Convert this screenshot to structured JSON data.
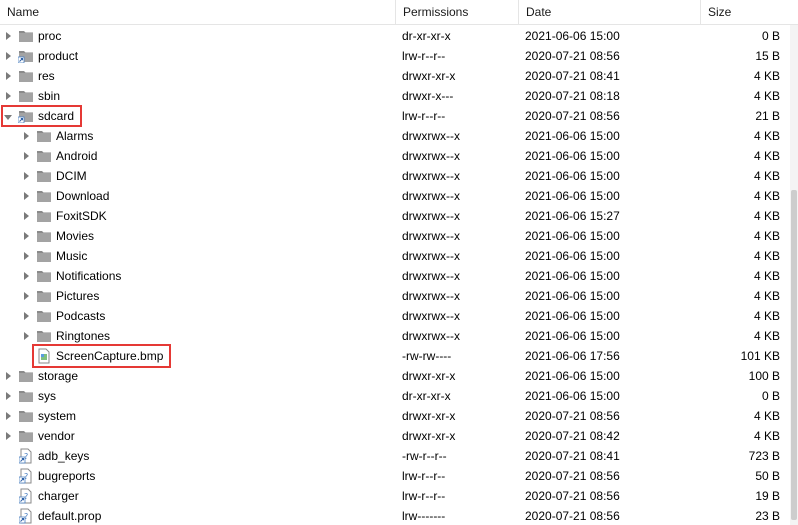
{
  "columns": {
    "name": "Name",
    "permissions": "Permissions",
    "date": "Date",
    "size": "Size"
  },
  "icons": {
    "folder": "folder-icon",
    "file": "file-icon",
    "link": "link-icon"
  },
  "colors": {
    "highlight": "#e53935",
    "folder": "#8a8a8a"
  },
  "rows": [
    {
      "name": "proc",
      "permissions": "dr-xr-xr-x",
      "date": "2021-06-06 15:00",
      "size": "0 B",
      "indent": 0,
      "expander": "collapsed",
      "icon": "folder"
    },
    {
      "name": "product",
      "permissions": "lrw-r--r--",
      "date": "2020-07-21 08:56",
      "size": "15 B",
      "indent": 0,
      "expander": "collapsed",
      "icon": "folder-link"
    },
    {
      "name": "res",
      "permissions": "drwxr-xr-x",
      "date": "2020-07-21 08:41",
      "size": "4 KB",
      "indent": 0,
      "expander": "collapsed",
      "icon": "folder"
    },
    {
      "name": "sbin",
      "permissions": "drwxr-x---",
      "date": "2020-07-21 08:18",
      "size": "4 KB",
      "indent": 0,
      "expander": "collapsed",
      "icon": "folder"
    },
    {
      "name": "sdcard",
      "permissions": "lrw-r--r--",
      "date": "2020-07-21 08:56",
      "size": "21 B",
      "indent": 0,
      "expander": "expanded",
      "icon": "folder-link"
    },
    {
      "name": "Alarms",
      "permissions": "drwxrwx--x",
      "date": "2021-06-06 15:00",
      "size": "4 KB",
      "indent": 1,
      "expander": "collapsed",
      "icon": "folder"
    },
    {
      "name": "Android",
      "permissions": "drwxrwx--x",
      "date": "2021-06-06 15:00",
      "size": "4 KB",
      "indent": 1,
      "expander": "collapsed",
      "icon": "folder"
    },
    {
      "name": "DCIM",
      "permissions": "drwxrwx--x",
      "date": "2021-06-06 15:00",
      "size": "4 KB",
      "indent": 1,
      "expander": "collapsed",
      "icon": "folder"
    },
    {
      "name": "Download",
      "permissions": "drwxrwx--x",
      "date": "2021-06-06 15:00",
      "size": "4 KB",
      "indent": 1,
      "expander": "collapsed",
      "icon": "folder"
    },
    {
      "name": "FoxitSDK",
      "permissions": "drwxrwx--x",
      "date": "2021-06-06 15:27",
      "size": "4 KB",
      "indent": 1,
      "expander": "collapsed",
      "icon": "folder"
    },
    {
      "name": "Movies",
      "permissions": "drwxrwx--x",
      "date": "2021-06-06 15:00",
      "size": "4 KB",
      "indent": 1,
      "expander": "collapsed",
      "icon": "folder"
    },
    {
      "name": "Music",
      "permissions": "drwxrwx--x",
      "date": "2021-06-06 15:00",
      "size": "4 KB",
      "indent": 1,
      "expander": "collapsed",
      "icon": "folder"
    },
    {
      "name": "Notifications",
      "permissions": "drwxrwx--x",
      "date": "2021-06-06 15:00",
      "size": "4 KB",
      "indent": 1,
      "expander": "collapsed",
      "icon": "folder"
    },
    {
      "name": "Pictures",
      "permissions": "drwxrwx--x",
      "date": "2021-06-06 15:00",
      "size": "4 KB",
      "indent": 1,
      "expander": "collapsed",
      "icon": "folder"
    },
    {
      "name": "Podcasts",
      "permissions": "drwxrwx--x",
      "date": "2021-06-06 15:00",
      "size": "4 KB",
      "indent": 1,
      "expander": "collapsed",
      "icon": "folder"
    },
    {
      "name": "Ringtones",
      "permissions": "drwxrwx--x",
      "date": "2021-06-06 15:00",
      "size": "4 KB",
      "indent": 1,
      "expander": "collapsed",
      "icon": "folder"
    },
    {
      "name": "ScreenCapture.bmp",
      "permissions": "-rw-rw----",
      "date": "2021-06-06 17:56",
      "size": "101 KB",
      "indent": 1,
      "expander": "none",
      "icon": "file"
    },
    {
      "name": "storage",
      "permissions": "drwxr-xr-x",
      "date": "2021-06-06 15:00",
      "size": "100 B",
      "indent": 0,
      "expander": "collapsed",
      "icon": "folder"
    },
    {
      "name": "sys",
      "permissions": "dr-xr-xr-x",
      "date": "2021-06-06 15:00",
      "size": "0 B",
      "indent": 0,
      "expander": "collapsed",
      "icon": "folder"
    },
    {
      "name": "system",
      "permissions": "drwxr-xr-x",
      "date": "2020-07-21 08:56",
      "size": "4 KB",
      "indent": 0,
      "expander": "collapsed",
      "icon": "folder"
    },
    {
      "name": "vendor",
      "permissions": "drwxr-xr-x",
      "date": "2020-07-21 08:42",
      "size": "4 KB",
      "indent": 0,
      "expander": "collapsed",
      "icon": "folder"
    },
    {
      "name": "adb_keys",
      "permissions": "-rw-r--r--",
      "date": "2020-07-21 08:41",
      "size": "723 B",
      "indent": 0,
      "expander": "none",
      "icon": "file-unknown"
    },
    {
      "name": "bugreports",
      "permissions": "lrw-r--r--",
      "date": "2020-07-21 08:56",
      "size": "50 B",
      "indent": 0,
      "expander": "none",
      "icon": "file-unknown"
    },
    {
      "name": "charger",
      "permissions": "lrw-r--r--",
      "date": "2020-07-21 08:56",
      "size": "19 B",
      "indent": 0,
      "expander": "none",
      "icon": "file-unknown"
    },
    {
      "name": "default.prop",
      "permissions": "lrw-------",
      "date": "2020-07-21 08:56",
      "size": "23 B",
      "indent": 0,
      "expander": "none",
      "icon": "file-unknown"
    }
  ]
}
